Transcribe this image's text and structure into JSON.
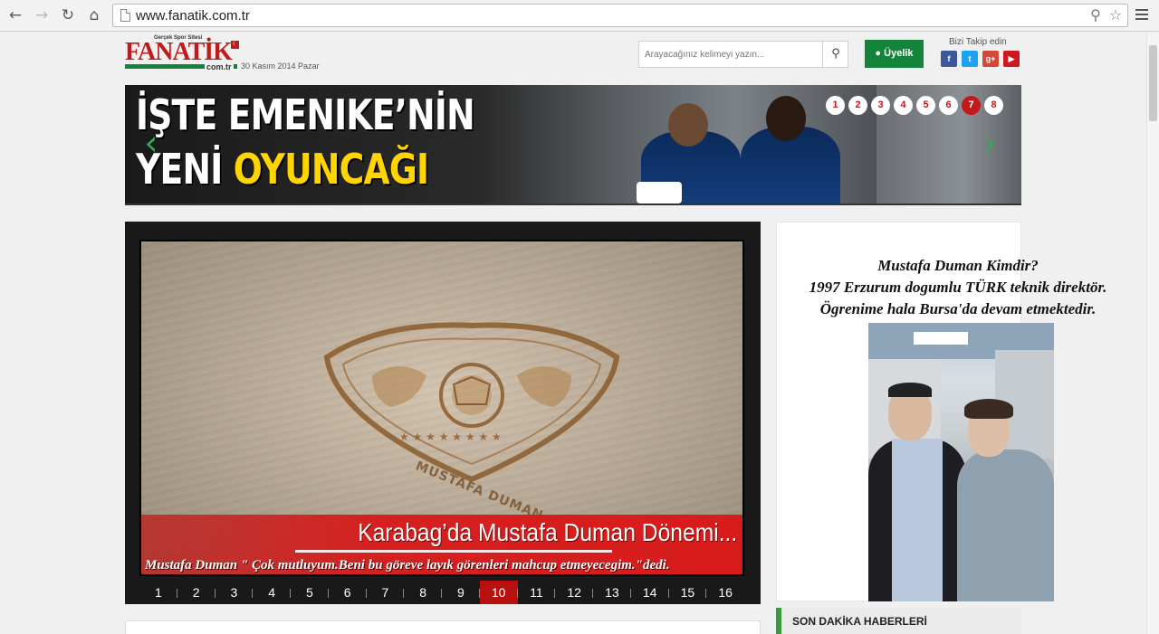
{
  "browser": {
    "url": "www.fanatik.com.tr"
  },
  "site": {
    "logo_tagline": "Gerçek Spor Sitesi",
    "logo_text": "FANATİK",
    "logo_domain": "com.tr",
    "date": "30 Kasım 2014 Pazar",
    "search_placeholder": "Arayacağınız kelimeyi yazın...",
    "member_button": "Üyelik",
    "follow_label": "Bizi Takip edin",
    "social": [
      "facebook-icon",
      "twitter-icon",
      "google-plus-icon",
      "youtube-icon"
    ]
  },
  "banner": {
    "line1": "İŞTE EMENIKE’NİN",
    "line2_prefix": "YENİ ",
    "line2_highlight": "OYUNCAĞI",
    "dots": [
      "1",
      "2",
      "3",
      "4",
      "5",
      "6",
      "7",
      "8"
    ],
    "active_dot": "7"
  },
  "slider": {
    "engraving": "MUSTAFA DUMAN",
    "caption_title": "Karabag’da Mustafa Duman Dönemi...",
    "caption_sub": "Mustafa Duman \" Çok mutluyum.Beni bu göreve layık görenleri mahcup etmeyecegim.\"dedi.",
    "pages": [
      "1",
      "2",
      "3",
      "4",
      "5",
      "6",
      "7",
      "8",
      "9",
      "10",
      "11",
      "12",
      "13",
      "14",
      "15",
      "16"
    ],
    "active_page": "10"
  },
  "sidebar_ad": {
    "line1": "Mustafa Duman Kimdir?",
    "line2": "1997 Erzurum dogumlu TÜRK teknik direktör.",
    "line3": "Ögrenime hala Bursa'da devam etmektedir."
  },
  "son_dakika": {
    "title": "SON DAKİKA HABERLERİ"
  },
  "colors": {
    "brand_red": "#c21a1a",
    "brand_green": "#14843a",
    "highlight_yellow": "#ffd400"
  }
}
